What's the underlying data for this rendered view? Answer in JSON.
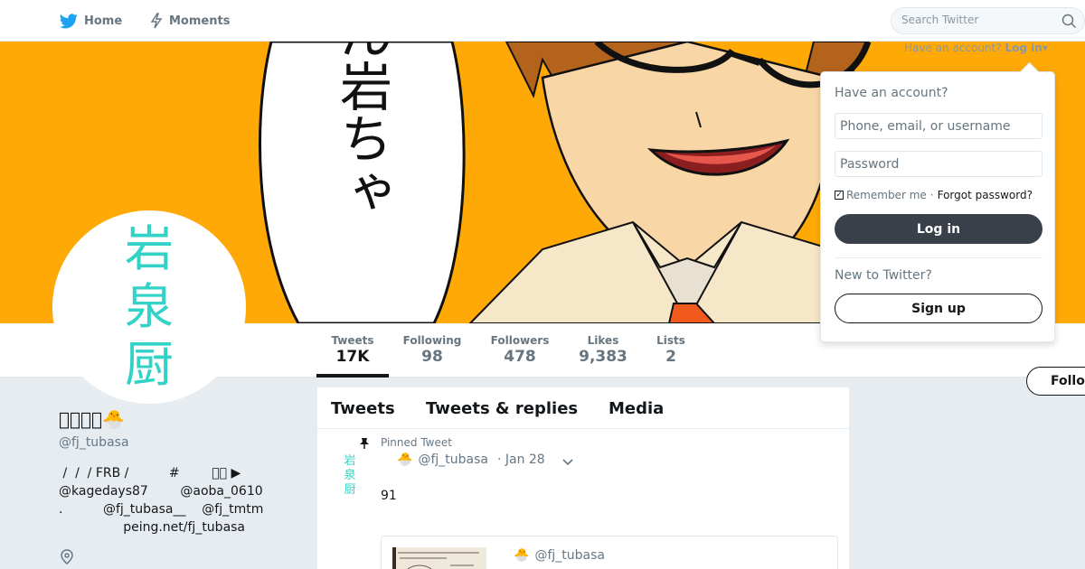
{
  "nav": {
    "home_label": "Home",
    "moments_label": "Moments",
    "search_placeholder": "Search Twitter",
    "account_prompt": "Have an account?",
    "login_link": "Log in"
  },
  "banner": {
    "speech_text": "ごめん岩ちゃ"
  },
  "profile": {
    "avatar_chars": [
      "岩",
      "泉",
      "厨"
    ],
    "name": "􀀀􀀀􀀀􀀀🐣",
    "handle": "@fj_tubasa",
    "bio_lines": [
      " /  /  / FRB /          #        􀀀􀀀 ▶",
      "@kagedays87        @aoba_0610",
      ".          @fj_tubasa__    @fj_tmtm",
      "                peing.net/fj_tubasa"
    ]
  },
  "stats": [
    {
      "label": "Tweets",
      "value": "17K"
    },
    {
      "label": "Following",
      "value": "98"
    },
    {
      "label": "Followers",
      "value": "478"
    },
    {
      "label": "Likes",
      "value": "9,383"
    },
    {
      "label": "Lists",
      "value": "2"
    }
  ],
  "follow_label": "Follow",
  "timeline": {
    "tabs": [
      "Tweets",
      "Tweets & replies",
      "Media"
    ],
    "pinned_label": "Pinned Tweet",
    "tweet": {
      "avatar_chars": [
        "岩",
        "泉",
        "厨"
      ],
      "emoji": "🐣",
      "handle": "@fj_tubasa",
      "date": "· Jan 28",
      "text": "91",
      "quote": {
        "emoji": "🐣",
        "handle": "@fj_tubasa"
      }
    }
  },
  "login_card": {
    "heading": "Have an account?",
    "username_placeholder": "Phone, email, or username",
    "password_placeholder": "Password",
    "remember_label": "Remember me",
    "separator": "·",
    "forgot_label": "Forgot password?",
    "login_button": "Log in",
    "new_heading": "New to Twitter?",
    "signup_button": "Sign up"
  },
  "colors": {
    "banner": "#ffa907",
    "avatar_text": "#33d2c6",
    "login_button_bg": "#394049"
  }
}
